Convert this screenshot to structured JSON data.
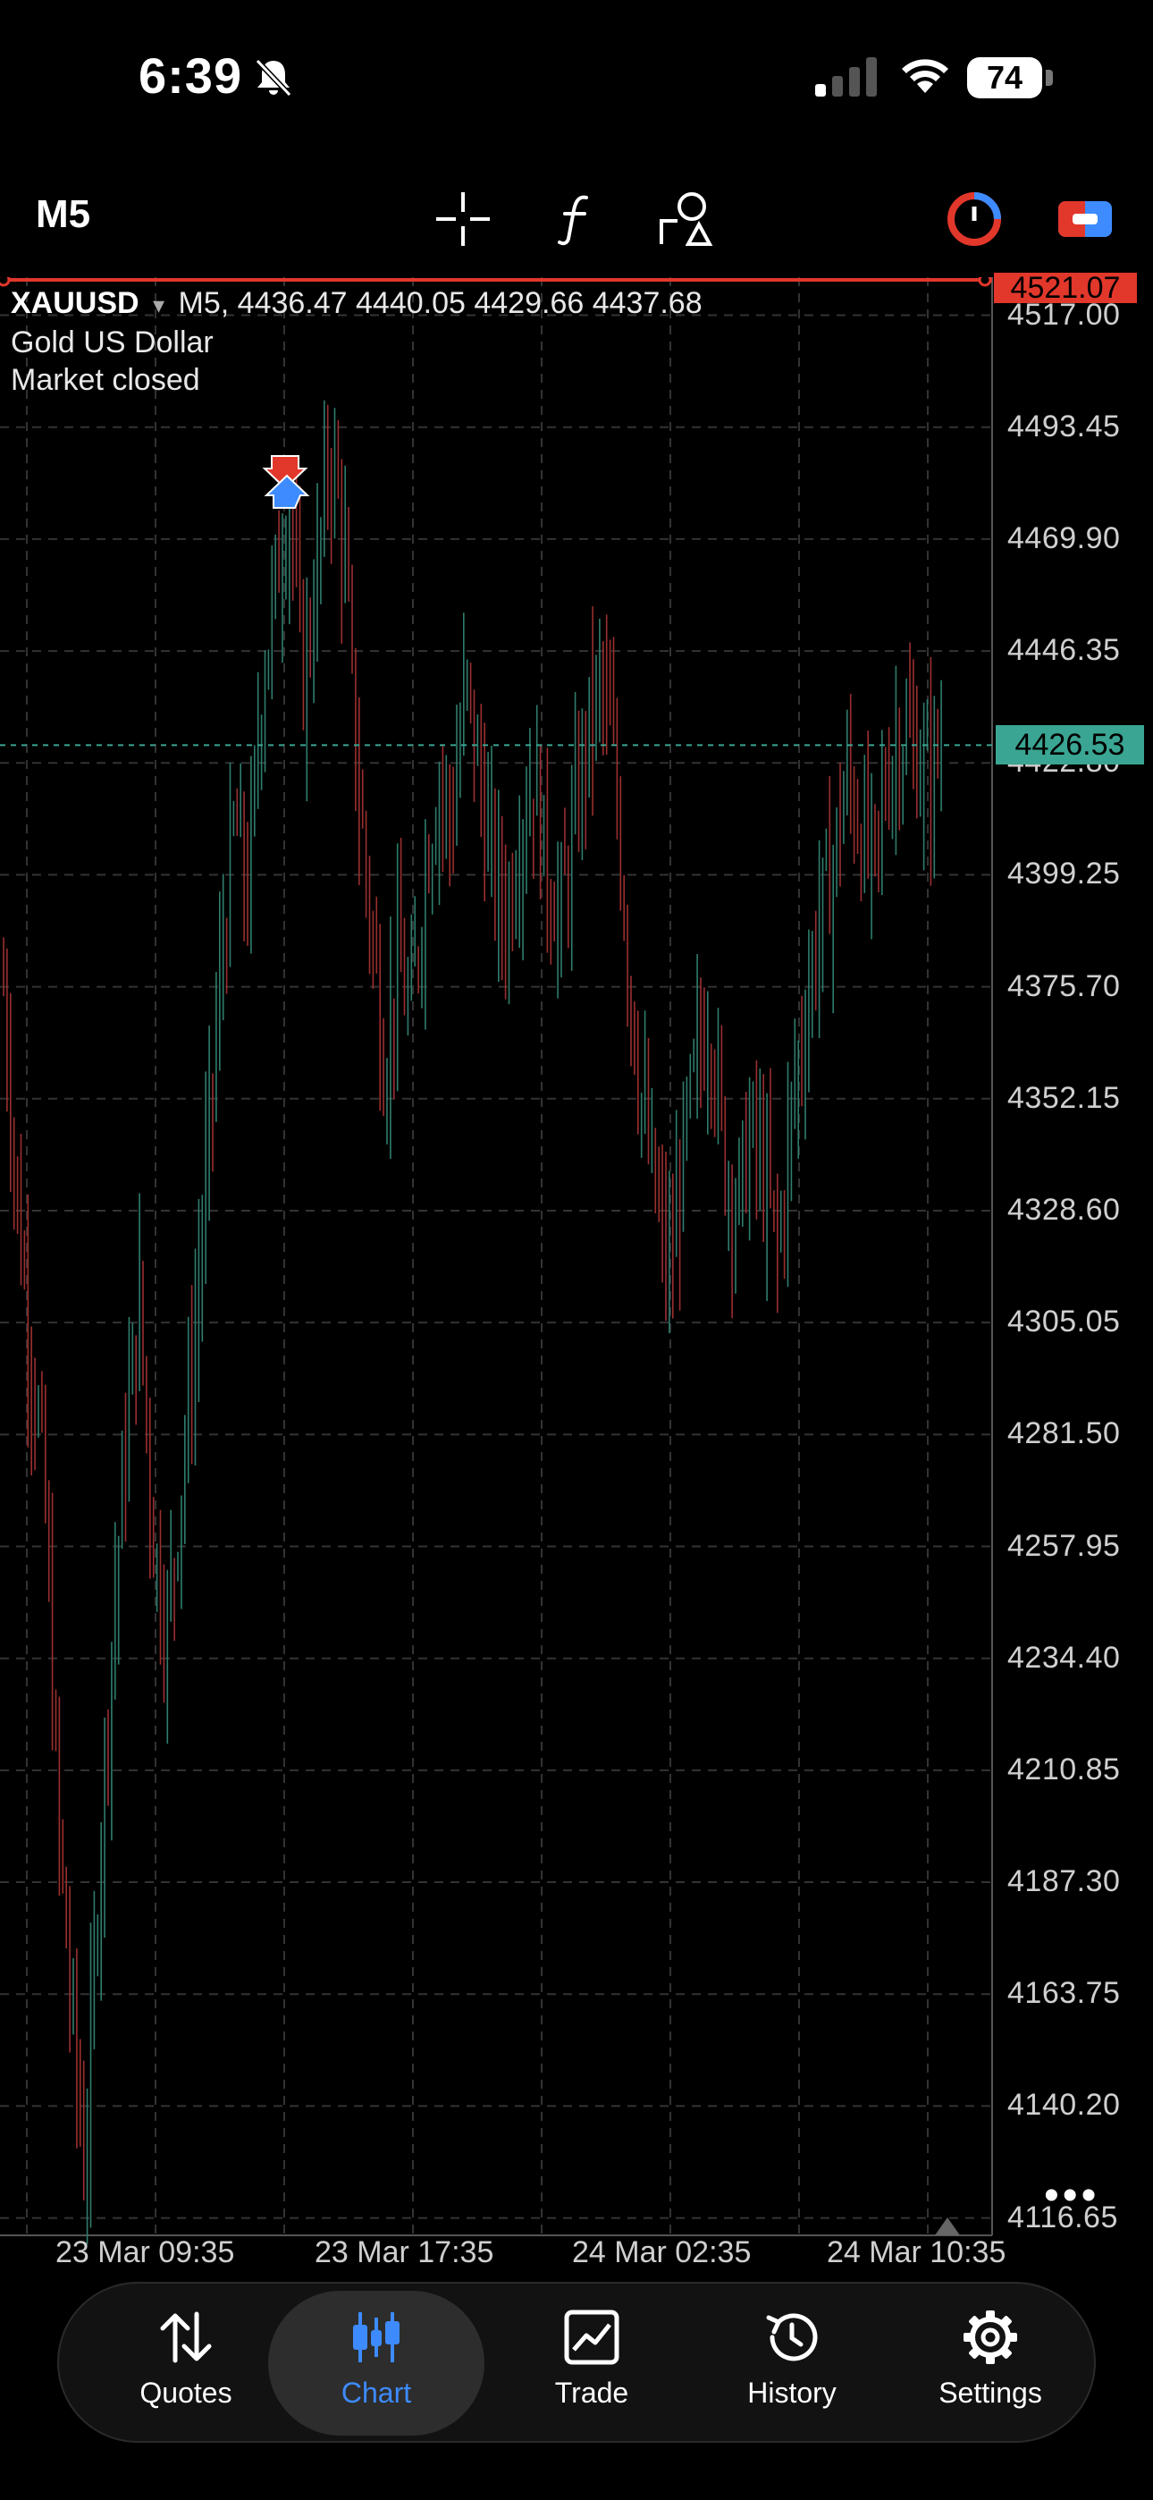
{
  "status_bar": {
    "time": "6:39",
    "battery": "74"
  },
  "toolbar": {
    "timeframe": "M5"
  },
  "chart": {
    "symbol": "XAUUSD",
    "dropdown_glyph": "▾",
    "ohlc_line": "M5, 4436.47 4440.05 4429.66 4437.68",
    "description": "Gold US Dollar",
    "market_status": "Market closed",
    "current_price": "4426.53",
    "top_price": "4521.07",
    "more": "•••",
    "price_labels": [
      "4517.00",
      "4493.45",
      "4469.90",
      "4446.35",
      "4422.80",
      "4399.25",
      "4375.70",
      "4352.15",
      "4328.60",
      "4305.05",
      "4281.50",
      "4257.95",
      "4234.40",
      "4210.85",
      "4187.30",
      "4163.75",
      "4140.20",
      "4116.65"
    ],
    "time_labels": [
      "23 Mar 09:35",
      "23 Mar 17:35",
      "24 Mar 02:35",
      "24 Mar 10:35"
    ]
  },
  "chart_data": {
    "type": "candlestick",
    "symbol": "XAUUSD",
    "timeframe": "M5",
    "ylim": [
      4113,
      4525
    ],
    "close_path": [
      4376,
      4330,
      4300,
      4270,
      4200,
      4160,
      4125,
      4190,
      4240,
      4280,
      4310,
      4260,
      4240,
      4270,
      4300,
      4340,
      4380,
      4410,
      4395,
      4440,
      4460,
      4480,
      4440,
      4460,
      4490,
      4470,
      4420,
      4390,
      4360,
      4380,
      4370,
      4400,
      4420,
      4410,
      4440,
      4420,
      4400,
      4390,
      4410,
      4420,
      4400,
      4390,
      4410,
      4430,
      4440,
      4420,
      4380,
      4350,
      4330,
      4315,
      4340,
      4360,
      4370,
      4340,
      4330,
      4345,
      4335,
      4320,
      4350,
      4370,
      4390,
      4400,
      4420,
      4410,
      4400,
      4420,
      4430,
      4425,
      4420,
      4426
    ],
    "current_price": 4426.53,
    "top_level": 4521.07
  },
  "colors": {
    "accent": "#3d8bff",
    "bid_line": "#3aa592",
    "ask_line": "#e2372b",
    "bg": "#000000"
  },
  "tabs": [
    {
      "label": "Quotes",
      "icon": "quotes-arrows-icon"
    },
    {
      "label": "Chart",
      "icon": "candlestick-chart-icon"
    },
    {
      "label": "Trade",
      "icon": "trade-line-chart-icon"
    },
    {
      "label": "History",
      "icon": "history-clock-icon"
    },
    {
      "label": "Settings",
      "icon": "gear-icon"
    }
  ]
}
